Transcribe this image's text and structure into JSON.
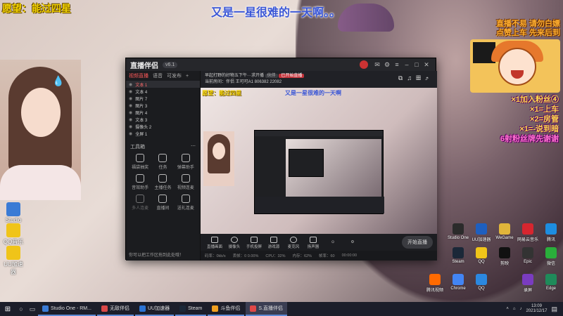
{
  "overlay": {
    "top_caption": "又是一星很难的一天啊。。",
    "wish": "愿望：能过四星",
    "rules": [
      "直播不易 请勿白嫖",
      "点赞上车 先来后到"
    ],
    "list": [
      "×1加入粉丝④",
      "×1=上车",
      "×2=房管",
      "×1=-说到暗",
      "6射粉丝牌先谢谢"
    ]
  },
  "app": {
    "name": "直播伴侣",
    "version": "v6.1",
    "tabs": [
      "视频直播",
      "语音",
      "可发布",
      "+"
    ],
    "sources": [
      {
        "label": "文本 1",
        "selected": true
      },
      {
        "label": "文本 4",
        "selected": false
      },
      {
        "label": "图片 7",
        "selected": false
      },
      {
        "label": "图片 3",
        "selected": false
      },
      {
        "label": "图片 4",
        "selected": false
      },
      {
        "label": "文本 3",
        "selected": false
      },
      {
        "label": "摄像头 2",
        "selected": false
      },
      {
        "label": "全屏 1",
        "selected": false
      }
    ],
    "tools_title": "工具箱",
    "tools": [
      {
        "label": "福袋抽奖",
        "dim": false
      },
      {
        "label": "任务",
        "dim": false
      },
      {
        "label": "弹幕助手",
        "dim": false
      },
      {
        "label": "音效助手",
        "dim": false
      },
      {
        "label": "主播任务",
        "dim": false
      },
      {
        "label": "视频连麦",
        "dim": false
      },
      {
        "label": "多人连麦",
        "dim": true
      },
      {
        "label": "直播间",
        "dim": false
      },
      {
        "label": "送礼连麦",
        "dim": false
      }
    ],
    "footer_hint": "你可以把工作区拖到此处哦！",
    "stream_title": "早起打野的好物五下午···求开播",
    "stream_tag_a": "伙伴",
    "stream_tag_b": "已开始直播",
    "stream_meta": "当前房间：伴侣   王可可A1   806382   22082",
    "preview_text_a": "愿望：能过四星",
    "preview_text_b": "又是一星很难的一天啊",
    "toolbar": [
      {
        "label": "直播画面"
      },
      {
        "label": "摄像头"
      },
      {
        "label": "手机投屏"
      },
      {
        "label": "游戏源"
      },
      {
        "label": "麦克风"
      },
      {
        "label": "扬声器"
      }
    ],
    "start_live": "开始直播",
    "status": [
      "码率：0kb/s",
      "丢帧：0 0.00%",
      "CPU：32%",
      "内存：62%",
      "帧率：60",
      "00:00:00"
    ]
  },
  "desktop_left": [
    {
      "label": "Studio One"
    },
    {
      "label": "QQ音乐"
    },
    {
      "label": "UU加速器"
    }
  ],
  "desktop_right": [
    {
      "label": "Studio One",
      "color": "#2b2b2b"
    },
    {
      "label": "UU加速器",
      "color": "#1e5fbf"
    },
    {
      "label": "WeGame",
      "color": "#e0b53a"
    },
    {
      "label": "网易云音乐",
      "color": "#d6262f"
    },
    {
      "label": "腾讯",
      "color": "#1d8de0"
    },
    {
      "label": "Steam",
      "color": "#1b2838"
    },
    {
      "label": "QQ",
      "color": "#f0c419"
    },
    {
      "label": "剪映",
      "color": "#111111"
    },
    {
      "label": "Epic",
      "color": "#333333"
    },
    {
      "label": "微信",
      "color": "#2aae3b"
    },
    {
      "label": "腾讯视频",
      "color": "#ff6a00"
    },
    {
      "label": "Chrome",
      "color": "#4285f4"
    },
    {
      "label": "QQ",
      "color": "#2b88e0"
    },
    {
      "label": "录屏",
      "color": "#7a3cc0"
    },
    {
      "label": "Edge",
      "color": "#1f8b5a"
    }
  ],
  "taskbar": {
    "tasks": [
      {
        "label": "Studio One - RM...",
        "color": "#3a7bd5",
        "active": false
      },
      {
        "label": "无敌伴侣",
        "color": "#d94848",
        "active": false
      },
      {
        "label": "UU加速器",
        "color": "#2b73d3",
        "active": false
      },
      {
        "label": "Steam",
        "color": "#1b2838",
        "active": false
      },
      {
        "label": "斗鱼伴侣",
        "color": "#f0a020",
        "active": false
      },
      {
        "label": "S.直播伴侣",
        "color": "#e04848",
        "active": true
      }
    ],
    "time": "13:09",
    "date": "2021/12/17"
  }
}
